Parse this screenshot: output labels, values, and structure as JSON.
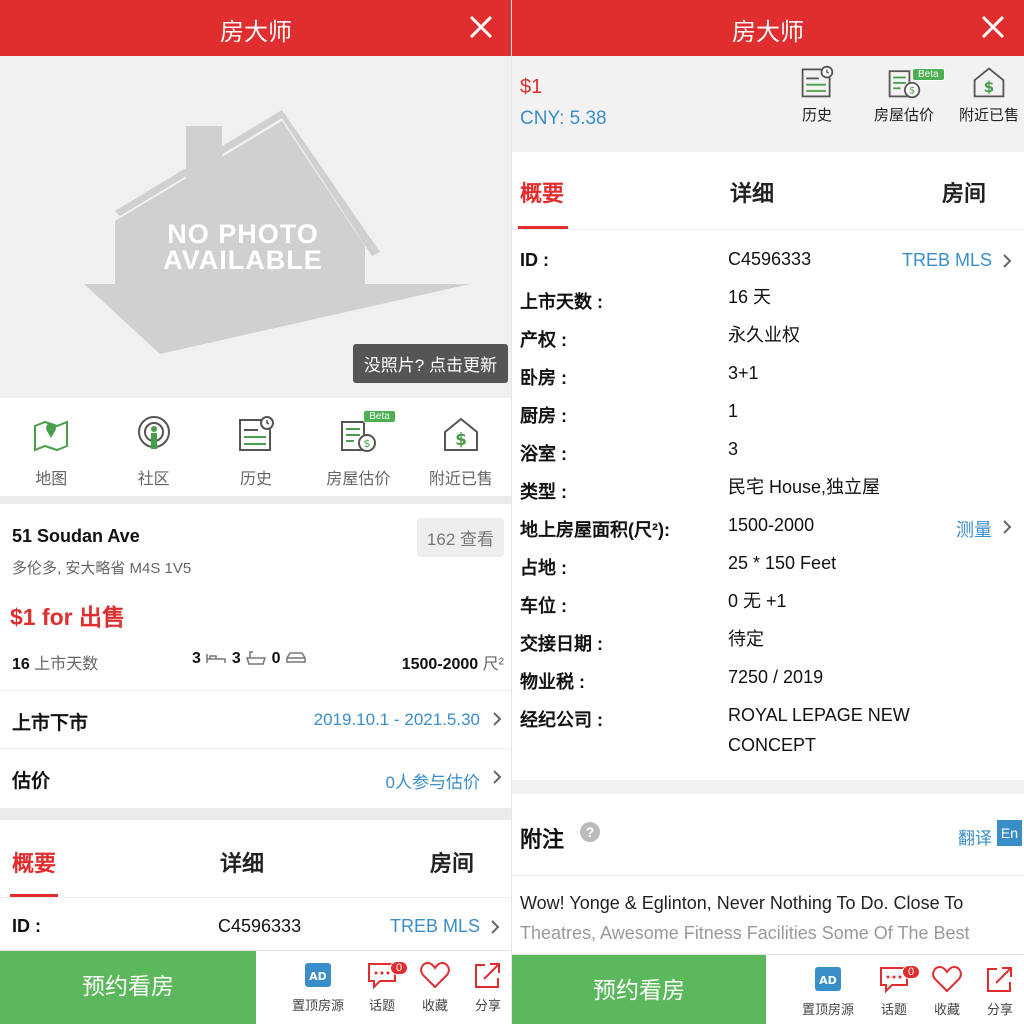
{
  "left": {
    "app_title": "房大师",
    "photo_overlay": "NO PHOTO AVAILABLE",
    "photo_tip": "没照片? 点击更新",
    "icons": [
      {
        "label": "地图",
        "icon": "map-icon"
      },
      {
        "label": "社区",
        "icon": "community-icon"
      },
      {
        "label": "历史",
        "icon": "history-icon"
      },
      {
        "label": "房屋估价",
        "icon": "valuation-icon",
        "badge": "Beta"
      },
      {
        "label": "附近已售",
        "icon": "nearby-sold-icon"
      }
    ],
    "listing": {
      "address": "51 Soudan Ave",
      "views": "162 查看",
      "city": "多伦多, 安大略省 M4S 1V5",
      "price": "$1 for 出售",
      "days_num": "16",
      "days_label": "上市天数",
      "beds": "3",
      "baths": "3",
      "parking": "0",
      "area": "1500-2000",
      "area_unit": "尺²"
    },
    "history_row": {
      "label": "上市下市",
      "value": "2019.10.1 - 2021.5.30"
    },
    "estimate_row": {
      "label": "估价",
      "value": "0人参与估价"
    },
    "tabs": [
      "概要",
      "详细",
      "房间"
    ],
    "id_row": {
      "key": "ID :",
      "value": "C4596333",
      "link": "TREB MLS"
    },
    "bottom": {
      "book": "预约看房",
      "items": [
        {
          "label": "置顶房源",
          "icon": "ad-icon"
        },
        {
          "label": "话题",
          "icon": "comment-icon",
          "badge": "0"
        },
        {
          "label": "收藏",
          "icon": "heart-icon"
        },
        {
          "label": "分享",
          "icon": "share-icon"
        }
      ]
    }
  },
  "right": {
    "app_title": "房大师",
    "price": "$1",
    "cny": "CNY: 5.38",
    "icons": [
      {
        "label": "历史",
        "icon": "history-icon"
      },
      {
        "label": "房屋估价",
        "icon": "valuation-icon",
        "badge": "Beta"
      },
      {
        "label": "附近已售",
        "icon": "nearby-sold-icon"
      }
    ],
    "tabs": [
      "概要",
      "详细",
      "房间"
    ],
    "details": [
      {
        "key": "ID :",
        "value": "C4596333",
        "link": "TREB MLS"
      },
      {
        "key": "上市天数 :",
        "value": "16 天"
      },
      {
        "key": "产权 :",
        "value": "永久业权"
      },
      {
        "key": "卧房 :",
        "value": "3+1"
      },
      {
        "key": "厨房 :",
        "value": "1"
      },
      {
        "key": "浴室 :",
        "value": "3"
      },
      {
        "key": "类型 :",
        "value": "民宅 House,独立屋"
      },
      {
        "key": "地上房屋面积(尺²):",
        "value": "1500-2000",
        "link": "测量"
      },
      {
        "key": "占地 :",
        "value": "25 * 150 Feet"
      },
      {
        "key": "车位 :",
        "value": "0 无 +1"
      },
      {
        "key": "交接日期 :",
        "value": "待定"
      },
      {
        "key": "物业税 :",
        "value": "7250 / 2019"
      },
      {
        "key": "经纪公司 :",
        "value": "ROYAL LEPAGE NEW CONCEPT"
      }
    ],
    "notes": {
      "title": "附注",
      "help": "?",
      "translate": "翻译",
      "lang": "En",
      "line1": "Wow! Yonge & Eglinton, Never Nothing To Do. Close To",
      "line2": "Theatres, Awesome Fitness Facilities Some Of The Best"
    },
    "bottom": {
      "book": "预约看房",
      "items": [
        {
          "label": "置顶房源",
          "icon": "ad-icon"
        },
        {
          "label": "话题",
          "icon": "comment-icon",
          "badge": "0"
        },
        {
          "label": "收藏",
          "icon": "heart-icon"
        },
        {
          "label": "分享",
          "icon": "share-icon"
        }
      ]
    }
  },
  "colors": {
    "brand_red": "#e02e2e",
    "link_blue": "#3a8ec8",
    "book_green": "#5cb85c"
  }
}
